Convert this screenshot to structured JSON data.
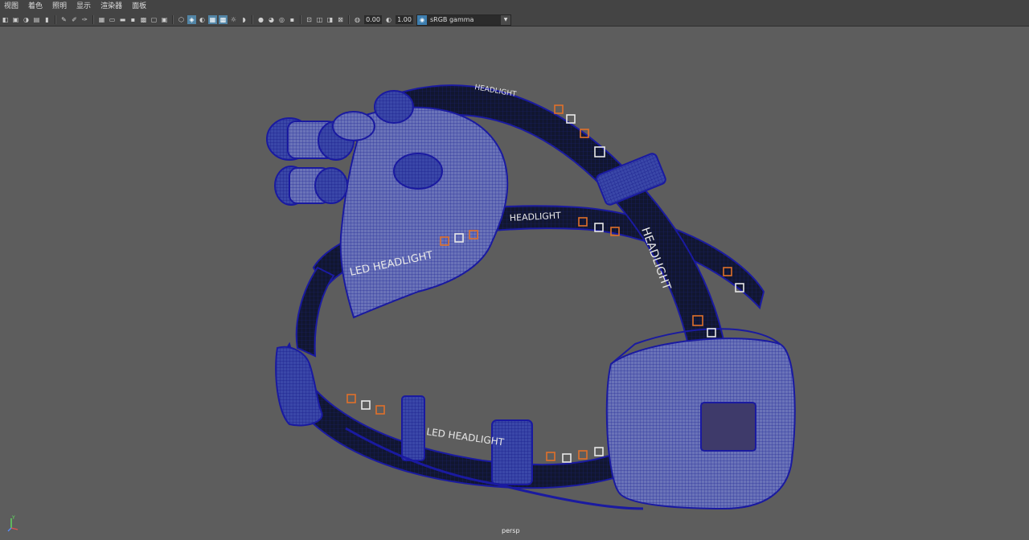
{
  "menu": {
    "items": [
      "视图",
      "着色",
      "照明",
      "显示",
      "渲染器",
      "面板"
    ]
  },
  "toolbar": {
    "exposure_value": "0.00",
    "gamma_value": "1.00",
    "color_management": "sRGB gamma"
  },
  "viewport": {
    "camera_label": "persp",
    "model": {
      "strap_text_side": "LED HEADLIGHT",
      "strap_text_top": "HEADLIGHT",
      "strap_text_top2": "HEADLIGHT",
      "strap_text_lower": "LED HEADLIGHT",
      "strap_text_back": "HEADLIGHT"
    },
    "axis": {
      "y": "Y",
      "z": "Z",
      "x": "X"
    }
  },
  "colors": {
    "background": "#5d5d5d",
    "wire": "#1a1aa0",
    "strap": "#121a3a",
    "accent_orange": "#e0702a",
    "ui_highlight": "#5285a6"
  }
}
